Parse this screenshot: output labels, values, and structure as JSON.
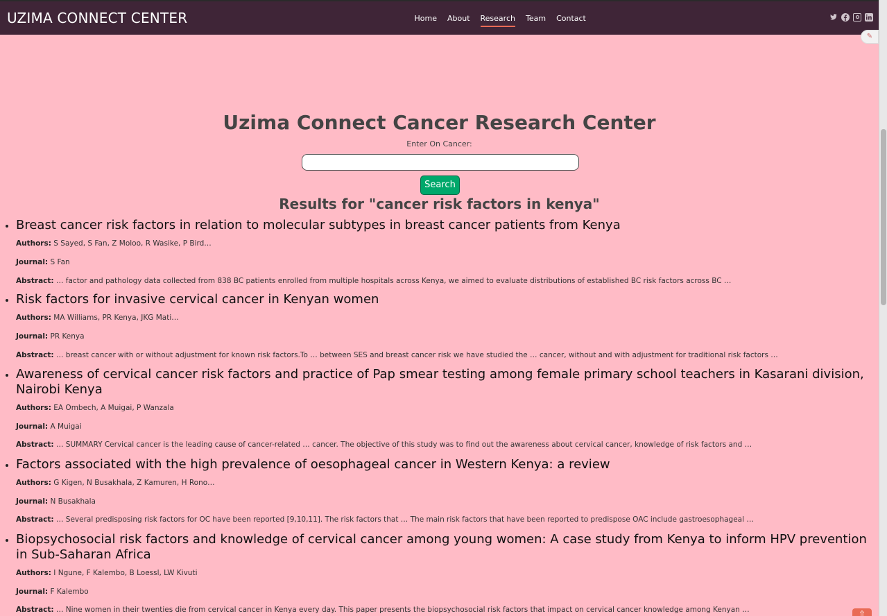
{
  "header": {
    "brand": "UZIMA CONNECT CENTER",
    "nav": [
      {
        "label": "Home",
        "active": false
      },
      {
        "label": "About",
        "active": false
      },
      {
        "label": "Research",
        "active": true
      },
      {
        "label": "Team",
        "active": false
      },
      {
        "label": "Contact",
        "active": false
      }
    ],
    "social_icons": [
      "twitter-icon",
      "facebook-icon",
      "instagram-icon",
      "linkedin-icon"
    ]
  },
  "hero": {
    "title": "Uzima Connect Cancer Research Center",
    "search_label": "Enter On Cancer:",
    "search_value": "",
    "search_button": "Search"
  },
  "results": {
    "heading": "Results for \"cancer risk factors in kenya\"",
    "labels": {
      "authors": "Authors:",
      "journal": "Journal:",
      "abstract": "Abstract:"
    },
    "items": [
      {
        "title": "Breast cancer risk factors in relation to molecular subtypes in breast cancer patients from Kenya",
        "authors": "S Sayed, S Fan, Z Moloo, R Wasike, P Bird…",
        "journal": "S Fan",
        "abstract": "… factor and pathology data collected from 838 BC patients enrolled from multiple hospitals across Kenya, we aimed to evaluate distributions of established BC risk factors across BC …"
      },
      {
        "title": "Risk factors for invasive cervical cancer in Kenyan women",
        "authors": "MA Williams, PR Kenya, JKG Mati…",
        "journal": "PR Kenya",
        "abstract": "… breast cancer with or without adjustment for known risk factors.To … between SES and breast cancer risk we have studied the … cancer, without and with adjustment for traditional risk factors …"
      },
      {
        "title": "Awareness of cervical cancer risk factors and practice of Pap smear testing among female primary school teachers in Kasarani division, Nairobi Kenya",
        "authors": "EA Ombech, A Muigai, P Wanzala",
        "journal": "A Muigai",
        "abstract": "… SUMMARY Cervical cancer is the leading cause of cancer-related … cancer. The objective of this study was to find out the awareness about cervical cancer, knowledge of risk factors and …"
      },
      {
        "title": "Factors associated with the high prevalence of oesophageal cancer in Western Kenya: a review",
        "authors": "G Kigen, N Busakhala, Z Kamuren, H Rono…",
        "journal": "N Busakhala",
        "abstract": "… Several predisposing risk factors for OC have been reported [9,10,11]. The risk factors that … The main risk factors that have been reported to predispose OAC include gastroesophageal …"
      },
      {
        "title": "Biopsychosocial risk factors and knowledge of cervical cancer among young women: A case study from Kenya to inform HPV prevention in Sub-Saharan Africa",
        "authors": "I Ngune, F Kalembo, B Loessl, LW Kivuti",
        "journal": "F Kalembo",
        "abstract": "… Nine women in their twenties die from cervical cancer in Kenya every day. This paper presents the biopsychosocial risk factors that impact on cervical cancer knowledge among Kenyan …"
      }
    ]
  },
  "colors": {
    "page_background": "#ffbbc6",
    "header_background": "#3f2537",
    "search_button": "#00a86b",
    "active_underline": "#e96b56"
  }
}
